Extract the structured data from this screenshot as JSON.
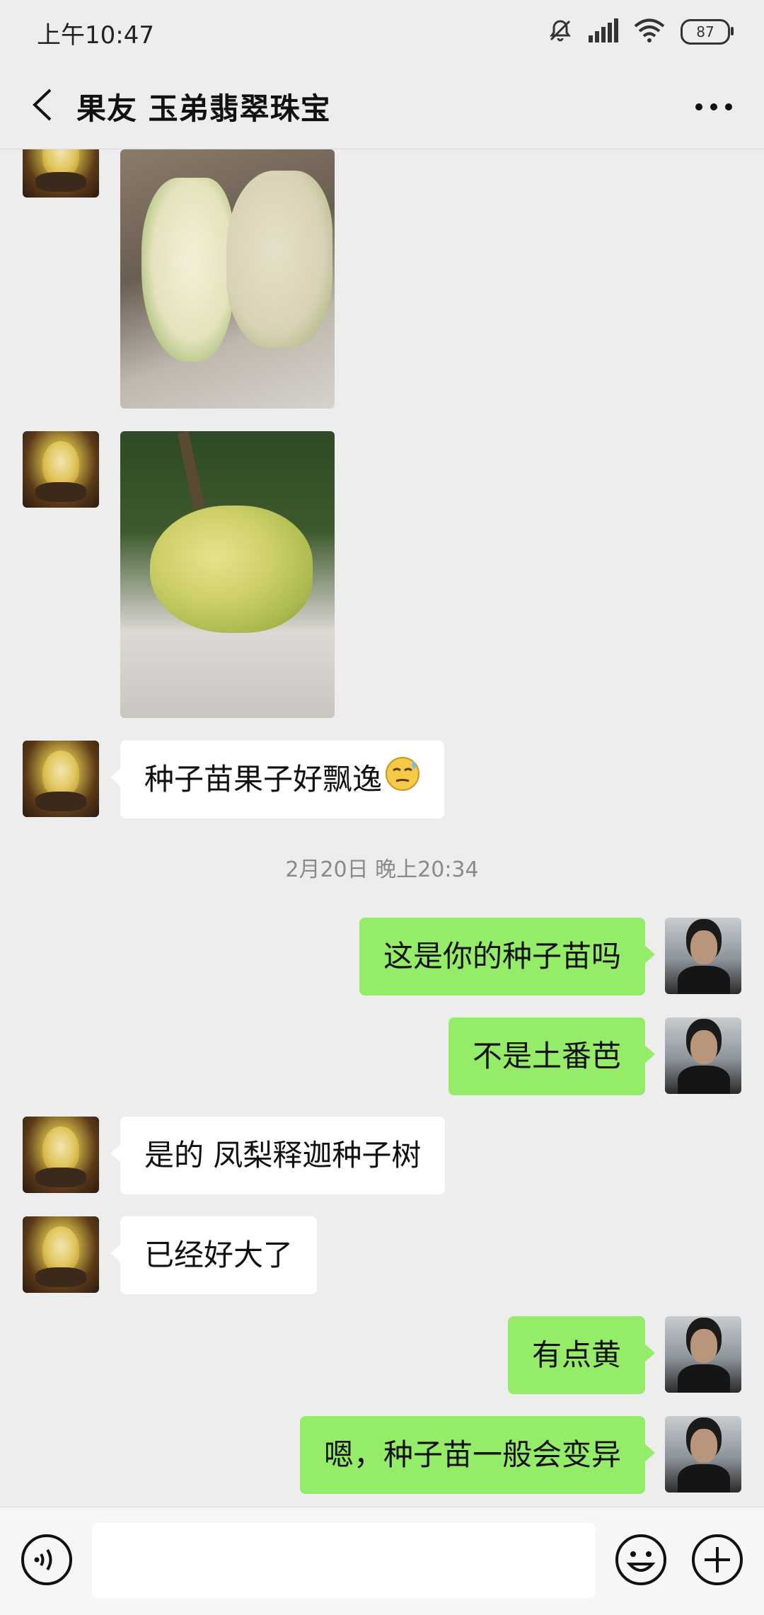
{
  "status_bar": {
    "time": "上午10:47",
    "battery": "87",
    "icons": [
      "mute-icon",
      "signal-icon",
      "wifi-icon",
      "battery-icon"
    ]
  },
  "header": {
    "title": "果友 玉弟翡翠珠宝",
    "back_icon": "back-arrow-icon",
    "more_icon": "more-dots-icon"
  },
  "messages": [
    {
      "side": "left",
      "type": "image",
      "content": "photo-cut-fruit"
    },
    {
      "side": "left",
      "type": "image",
      "content": "photo-fruit-on-tree"
    },
    {
      "side": "left",
      "type": "text",
      "text": "种子苗果子好飘逸",
      "emoji": "sweat-smile-emoji"
    },
    {
      "type": "timestamp",
      "text": "2月20日 晚上20:34"
    },
    {
      "side": "right",
      "type": "text",
      "text": "这是你的种子苗吗"
    },
    {
      "side": "right",
      "type": "text",
      "text": "不是土番芭"
    },
    {
      "side": "left",
      "type": "text",
      "text": "是的 凤梨释迦种子树"
    },
    {
      "side": "left",
      "type": "text",
      "text": "已经好大了"
    },
    {
      "side": "right",
      "type": "text",
      "text": "有点黄"
    },
    {
      "side": "right",
      "type": "text",
      "text": "嗯，种子苗一般会变异"
    }
  ],
  "input_bar": {
    "placeholder": "",
    "voice_icon": "voice-icon",
    "emoji_icon": "emoji-icon",
    "plus_icon": "plus-icon"
  },
  "colors": {
    "background": "#ededed",
    "own_bubble": "#95ec69",
    "other_bubble": "#ffffff"
  }
}
